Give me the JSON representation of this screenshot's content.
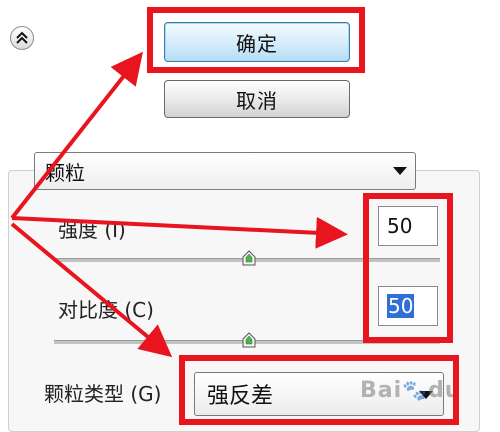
{
  "dialog": {
    "ok_label": "确定",
    "cancel_label": "取消"
  },
  "filter_select": {
    "value": "颗粒"
  },
  "controls": {
    "strength": {
      "label": "强度 (I)",
      "value": "50",
      "level": 0.5
    },
    "contrast": {
      "label": "对比度 (C)",
      "value": "50",
      "level": 0.5
    },
    "grain_type": {
      "label": "颗粒类型 (G)",
      "value": "强反差"
    }
  },
  "icons": {
    "collapse": "chevron-double-up-icon",
    "slider_thumb": "slider-thumb-icon",
    "dropdown_arrow": "chevron-down-icon"
  },
  "watermark": {
    "text": "Bai",
    "suffix": "du"
  },
  "colors": {
    "annotation_red": "#e8141e",
    "ok_button_blue": "#b7dcf4",
    "selection_blue": "#2f6fd6"
  }
}
